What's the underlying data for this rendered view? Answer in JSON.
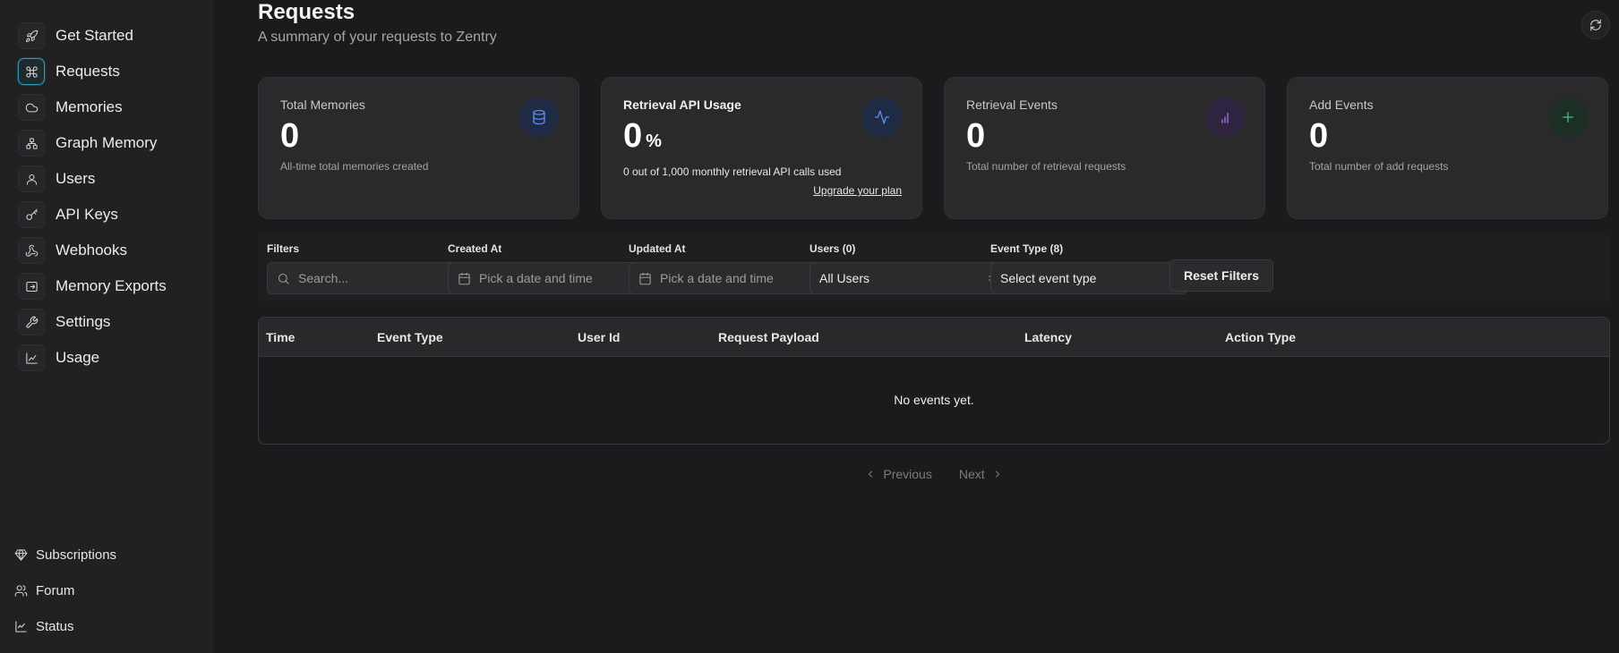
{
  "sidebar": {
    "items": [
      {
        "label": "Get Started",
        "icon": "rocket-icon"
      },
      {
        "label": "Requests",
        "icon": "command-icon",
        "active": true
      },
      {
        "label": "Memories",
        "icon": "cloud-icon"
      },
      {
        "label": "Graph Memory",
        "icon": "graph-icon"
      },
      {
        "label": "Users",
        "icon": "user-icon"
      },
      {
        "label": "API Keys",
        "icon": "key-icon"
      },
      {
        "label": "Webhooks",
        "icon": "webhook-icon"
      },
      {
        "label": "Memory Exports",
        "icon": "export-icon"
      },
      {
        "label": "Settings",
        "icon": "wrench-icon"
      },
      {
        "label": "Usage",
        "icon": "chart-icon"
      }
    ],
    "bottom": [
      {
        "label": "Subscriptions",
        "icon": "diamond-icon"
      },
      {
        "label": "Forum",
        "icon": "users-icon"
      },
      {
        "label": "Status",
        "icon": "line-chart-icon"
      }
    ]
  },
  "header": {
    "title": "Requests",
    "subtitle": "A summary of your requests to Zentry"
  },
  "cards": [
    {
      "title": "Total Memories",
      "value": "0",
      "desc": "All-time total memories created",
      "icon": "database-icon"
    },
    {
      "title": "Retrieval API Usage",
      "value": "0",
      "unit": "%",
      "desc": "0 out of 1,000 monthly retrieval API calls used",
      "link": "Upgrade your plan",
      "icon": "activity-icon"
    },
    {
      "title": "Retrieval Events",
      "value": "0",
      "desc": "Total number of retrieval requests",
      "icon": "bar-chart-icon"
    },
    {
      "title": "Add Events",
      "value": "0",
      "desc": "Total number of add requests",
      "icon": "plus-icon"
    }
  ],
  "filters": {
    "search_label": "Filters",
    "search_placeholder": "Search...",
    "created_label": "Created At",
    "created_placeholder": "Pick a date and time",
    "updated_label": "Updated At",
    "updated_placeholder": "Pick a date and time",
    "users_label": "Users (0)",
    "users_value": "All Users",
    "event_type_label": "Event Type (8)",
    "event_type_value": "Select event type",
    "reset_label": "Reset Filters"
  },
  "table": {
    "columns": [
      "Time",
      "Event Type",
      "User Id",
      "Request Payload",
      "Latency",
      "Action Type"
    ],
    "empty_text": "No events yet."
  },
  "pagination": {
    "previous": "Previous",
    "next": "Next"
  },
  "colors": {
    "accent_active": "#2a9bb3",
    "icon_blue": "#5b8dee",
    "icon_purple": "#a46ee6",
    "icon_green": "#3fc27a"
  }
}
